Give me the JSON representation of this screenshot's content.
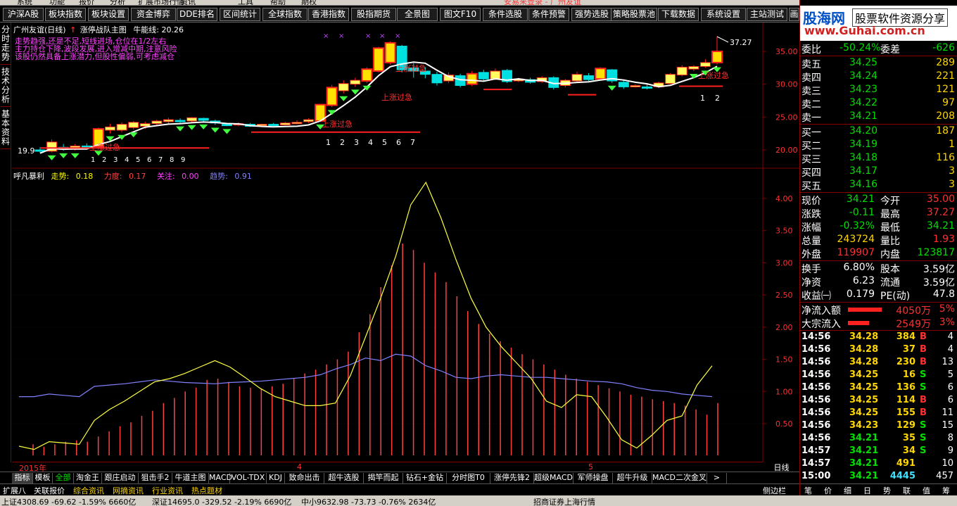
{
  "menu": {
    "items": [
      "系统",
      "功能",
      "报价",
      "分析",
      "扩展市场行情",
      "资讯",
      "工具",
      "帮助",
      "期权"
    ],
    "title": "安易来登录 - 广州友谊"
  },
  "nav": {
    "items": [
      "沪深A股",
      "板块指数",
      "板块设置",
      "资金博弈",
      "DDE排名",
      "区间统计",
      "全球指数",
      "香港指数",
      "股指期货",
      "全景图",
      "图文F10",
      "条件选股",
      "条件预警",
      "强势选股",
      "策略股票池",
      "下载数据",
      "系统设置",
      "主站测试",
      "画"
    ]
  },
  "left_tabs": [
    "分时走势",
    "技术分析",
    "基本资料"
  ],
  "price_chart": {
    "stock": "广州友谊(日线)",
    "formula": "涨停战队主图",
    "ma_label": "牛能线:",
    "ma_value": "20.26",
    "notes": [
      "走势趋强,还是不足,短线进场,仓位在1/2左右",
      "主力持仓下降,波段发展,进入增减中期,注意风险",
      "该股仍然具备上涨潜力,但股性偏弱,可考虑减仓"
    ],
    "ylabels": [
      "35.00",
      "30.00",
      "25.00",
      "20.00"
    ],
    "high_label": "37.27",
    "low_label": "19.9",
    "tag": "上涨过急",
    "counts_a": [
      "1",
      "2",
      "3",
      "4",
      "5",
      "6",
      "7",
      "8",
      "9"
    ],
    "counts_b": [
      "1",
      "2",
      "3",
      "4",
      "5",
      "6",
      "7"
    ],
    "counts_c": [
      "1",
      "2"
    ]
  },
  "indicator": {
    "name": "呼凡暴利",
    "items": [
      {
        "label": "走势:",
        "value": "0.18",
        "color": "#ffff00"
      },
      {
        "label": "力度:",
        "value": "0.17",
        "color": "#ff4040"
      },
      {
        "label": "关注:",
        "value": "0.00",
        "color": "#ff40ff"
      },
      {
        "label": "趋势:",
        "value": "0.91",
        "color": "#8080ff"
      }
    ],
    "ylabels": [
      "4.00",
      "3.50",
      "3.00",
      "2.50",
      "2.00",
      "1.50",
      "1.00",
      "0.50"
    ],
    "bars": [
      0.18,
      0.14,
      0.18,
      0.22,
      0.24,
      0.22,
      0.3,
      0.38,
      0.46,
      0.52,
      0.62,
      0.7,
      0.82,
      0.9,
      1.0,
      1.06,
      1.18,
      1.2,
      1.15,
      1.08,
      1.06,
      1.04,
      1.08,
      1.12,
      1.2,
      1.28,
      1.34,
      1.42,
      1.5,
      1.62,
      1.92,
      2.2,
      2.62,
      2.96,
      3.3,
      3.2,
      3.0,
      2.85,
      2.7,
      2.48,
      2.25,
      2.05,
      1.9,
      1.78,
      1.68,
      1.58,
      1.5,
      1.42,
      1.34,
      1.26,
      1.2,
      1.15,
      1.1,
      1.05,
      1.0,
      0.95,
      0.92,
      0.88,
      0.85,
      0.82,
      0.78,
      0.72,
      0.64,
      0.82
    ],
    "walk": [
      0.15,
      0.1,
      0.22,
      0.2,
      0.18,
      0.55,
      0.72,
      0.85,
      1.0,
      1.15,
      1.2,
      1.28,
      1.38,
      1.48,
      1.38,
      1.22,
      1.05,
      0.92,
      0.85,
      0.78,
      0.78,
      0.82,
      1.25,
      1.85,
      2.45,
      3.1,
      3.9,
      4.25,
      3.7,
      3.05,
      2.45,
      2.0,
      1.7,
      1.45,
      1.2,
      0.85,
      0.75,
      0.95,
      0.92,
      0.6,
      0.25,
      0.12,
      0.32,
      0.55,
      0.62,
      1.1,
      1.4
    ],
    "trend": [
      0.92,
      0.92,
      0.96,
      0.94,
      0.92,
      1.08,
      1.1,
      1.12,
      1.15,
      1.18,
      1.16,
      1.14,
      1.13,
      1.12,
      1.14,
      1.15,
      1.16,
      1.18,
      1.2,
      1.22,
      1.26,
      1.35,
      1.42,
      1.52,
      1.48,
      1.58,
      1.55,
      1.4,
      1.32,
      1.22,
      1.2,
      1.24,
      1.26,
      1.24,
      1.22,
      1.22,
      1.2,
      1.18,
      1.16,
      1.15,
      1.12,
      1.06,
      1.02,
      1.0,
      0.96,
      0.94,
      0.92
    ]
  },
  "date_axis": {
    "labels": [
      "2015年",
      "4",
      "5"
    ],
    "scale": "日线"
  },
  "bottom_tabs": [
    "指标",
    "模板",
    "全部",
    "淘金王",
    "跟庄启动",
    "狙击手2",
    "牛道主图",
    "MACD",
    "VOL-TDX",
    "KDJ",
    "致命出击",
    "超牛选股",
    "揭竿而起",
    "钻石+金钻",
    "分时图T0",
    "涨停先锋2",
    "超级MACD",
    "军师操盘",
    "超牛升级",
    "MACD二次金叉",
    ">"
  ],
  "info_tabs": [
    "扩展八",
    "关联报价",
    "综合资讯",
    "网摘资讯",
    "行业资讯",
    "热点题材",
    "侧边栏"
  ],
  "status": {
    "sh": "上证4308.69 -69.62 -1.59% 6660亿",
    "sz": "深证14695.0 -329.52 -2.19% 6690亿",
    "zx": "中小9632.98 -73.73 -0.76% 2634亿",
    "broker": "招商证券上海行情"
  },
  "quote": {
    "banner_logo": "股海网",
    "banner_tag": "股票软件资源分享",
    "banner_url": "www.Guhai.com.cn",
    "weibi": {
      "label": "委比",
      "value": "-50.24%",
      "label2": "委差",
      "value2": "-626"
    },
    "sell": [
      {
        "label": "卖五",
        "price": "34.25",
        "vol": "289"
      },
      {
        "label": "卖四",
        "price": "34.24",
        "vol": "221"
      },
      {
        "label": "卖三",
        "price": "34.23",
        "vol": "121"
      },
      {
        "label": "卖二",
        "price": "34.22",
        "vol": "97"
      },
      {
        "label": "卖一",
        "price": "34.21",
        "vol": "208"
      }
    ],
    "buy": [
      {
        "label": "买一",
        "price": "34.20",
        "vol": "187"
      },
      {
        "label": "买二",
        "price": "34.19",
        "vol": "1"
      },
      {
        "label": "买三",
        "price": "34.18",
        "vol": "116"
      },
      {
        "label": "买四",
        "price": "34.17",
        "vol": "3"
      },
      {
        "label": "买五",
        "price": "34.16",
        "vol": "3"
      }
    ],
    "stats1": [
      {
        "l1": "现价",
        "v1": "34.21",
        "c1": "green",
        "l2": "今开",
        "v2": "35.00",
        "c2": "red"
      },
      {
        "l1": "涨跌",
        "v1": "-0.11",
        "c1": "green",
        "l2": "最高",
        "v2": "37.27",
        "c2": "red"
      },
      {
        "l1": "涨幅",
        "v1": "-0.32%",
        "c1": "green",
        "l2": "最低",
        "v2": "34.21",
        "c2": "green"
      },
      {
        "l1": "总量",
        "v1": "243724",
        "c1": "yel",
        "l2": "量比",
        "v2": "1.93",
        "c2": "red"
      },
      {
        "l1": "外盘",
        "v1": "119907",
        "c1": "red",
        "l2": "内盘",
        "v2": "123817",
        "c2": "green"
      }
    ],
    "stats2": [
      {
        "l1": "换手",
        "v1": "6.80%",
        "l2": "股本",
        "v2": "3.59亿"
      },
      {
        "l1": "净资",
        "v1": "6.23",
        "l2": "流通",
        "v2": "3.59亿"
      },
      {
        "l1": "收益㈠",
        "v1": "0.179",
        "l2": "PE(动)",
        "v2": "47.8"
      }
    ],
    "flows": [
      {
        "label": "净流入额",
        "value": "4050万",
        "pct": "5%",
        "level": 0.72
      },
      {
        "label": "大宗流入",
        "value": "2549万",
        "pct": "3%",
        "level": 0.45
      }
    ],
    "ticks": [
      {
        "t": "14:56",
        "p": "34.28",
        "v": "384",
        "d": "B",
        "n": "4"
      },
      {
        "t": "14:56",
        "p": "34.28",
        "v": "37",
        "d": "B",
        "n": "4"
      },
      {
        "t": "14:56",
        "p": "34.28",
        "v": "230",
        "d": "B",
        "n": "13"
      },
      {
        "t": "14:56",
        "p": "34.25",
        "v": "16",
        "d": "S",
        "n": "5"
      },
      {
        "t": "14:56",
        "p": "34.25",
        "v": "136",
        "d": "S",
        "n": "6"
      },
      {
        "t": "14:56",
        "p": "34.25",
        "v": "114",
        "d": "B",
        "n": "6"
      },
      {
        "t": "14:56",
        "p": "34.25",
        "v": "155",
        "d": "B",
        "n": "11"
      },
      {
        "t": "14:56",
        "p": "34.23",
        "v": "129",
        "d": "S",
        "n": "15"
      },
      {
        "t": "14:56",
        "p": "34.21",
        "v": "35",
        "d": "S",
        "n": "8"
      },
      {
        "t": "14:57",
        "p": "34.21",
        "v": "34",
        "d": "S",
        "n": "9"
      },
      {
        "t": "14:57",
        "p": "34.21",
        "v": "491",
        "d": "",
        "n": "10"
      },
      {
        "t": "15:00",
        "p": "34.21",
        "v": "4445",
        "d": "",
        "n": "457"
      }
    ],
    "right_tabs": [
      "笔",
      "价",
      "细",
      "日",
      "势",
      "联",
      "值",
      "筹"
    ]
  },
  "colors": {
    "up": "#ff2020",
    "down": "#00e0e0",
    "ma": "#ffffff",
    "walk": "#ffff40",
    "trend": "#8080ff",
    "bar": "#ff4040",
    "grid": "#800000"
  }
}
